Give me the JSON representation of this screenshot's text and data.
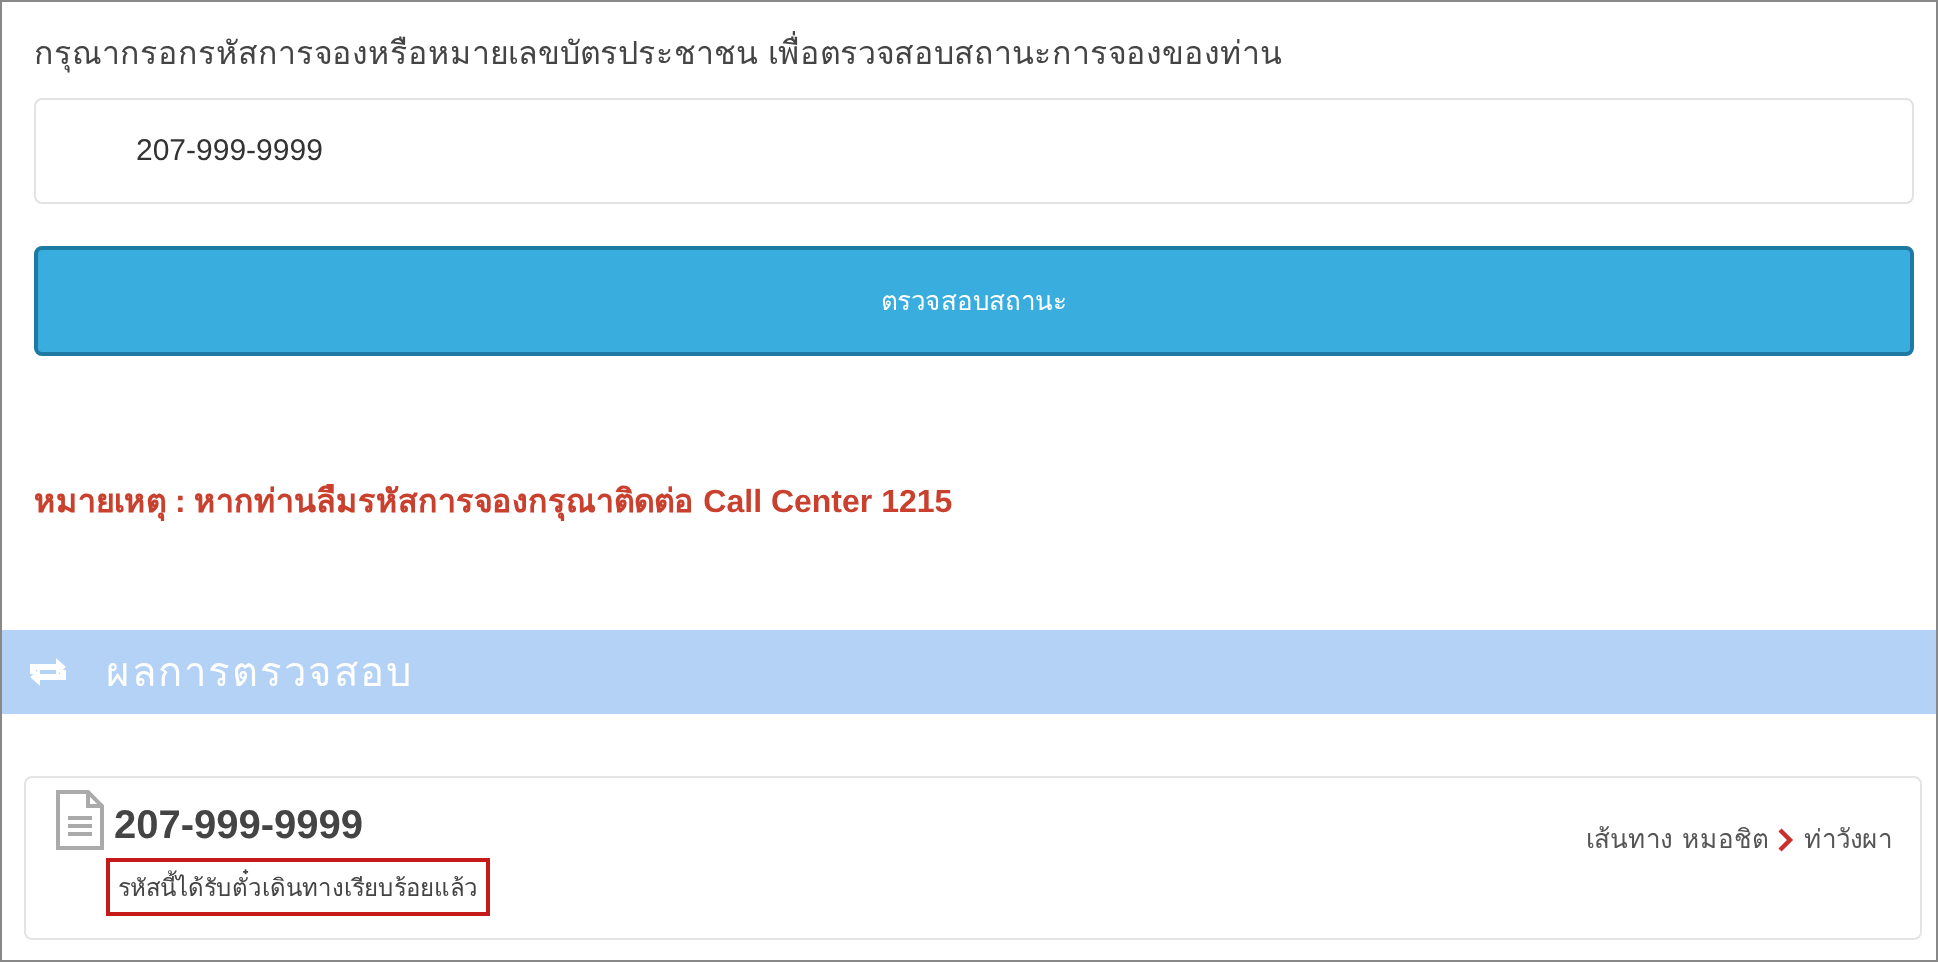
{
  "prompt": "กรุณากรอกรหัสการจองหรือหมายเลขบัตรประชาชน เพื่อตรวจสอบสถานะการจองของท่าน",
  "search": {
    "value": "207-999-9999"
  },
  "check_button": "ตรวจสอบสถานะ",
  "note": "หมายเหตุ : หากท่านลืมรหัสการจองกรุณาติดต่อ Call Center 1215",
  "results_header": "ผลการตรวจสอบ",
  "result": {
    "code": "207-999-9999",
    "status": "รหัสนี้ได้รับตั๋วเดินทางเรียบร้อยแล้ว",
    "highlighted": true,
    "route_label": "เส้นทาง",
    "origin": "หมอชิต",
    "destination": "ท่าวังผา"
  }
}
